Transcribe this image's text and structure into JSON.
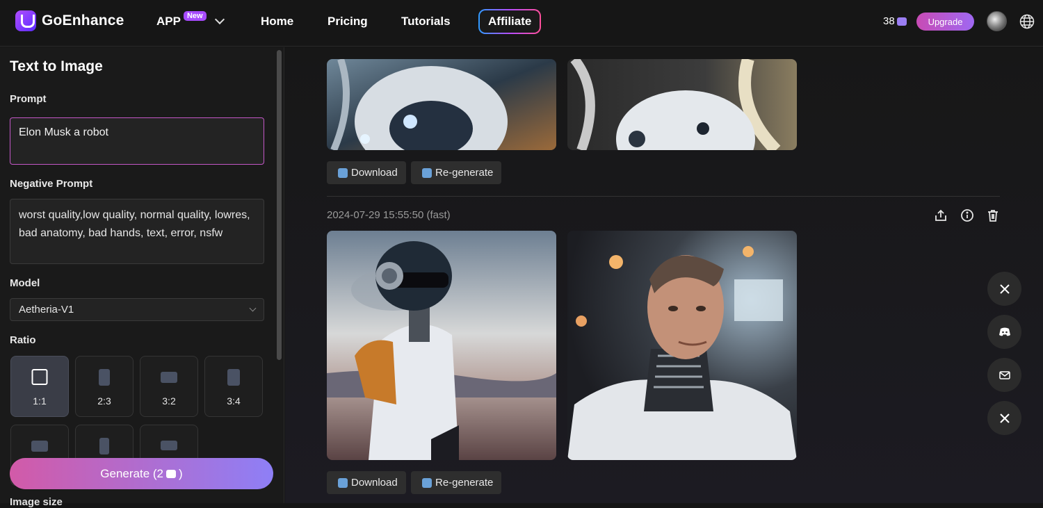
{
  "brand": {
    "name": "GoEnhance"
  },
  "nav": {
    "app": "APP",
    "new_badge": "New",
    "home": "Home",
    "pricing": "Pricing",
    "tutorials": "Tutorials",
    "affiliate": "Affiliate"
  },
  "account": {
    "credits": "38",
    "upgrade": "Upgrade"
  },
  "panel": {
    "title": "Text to Image",
    "prompt_label": "Prompt",
    "prompt_value": "Elon Musk a robot",
    "negative_label": "Negative Prompt",
    "negative_value": "worst quality,low quality, normal quality, lowres, bad anatomy, bad hands, text, error, nsfw",
    "model_label": "Model",
    "model_value": "Aetheria-V1",
    "ratio_label": "Ratio",
    "ratios": [
      "1:1",
      "2:3",
      "3:2",
      "3:4"
    ],
    "selected_ratio": "1:1",
    "generate": "Generate (2",
    "generate_suffix": ")",
    "image_size_label": "Image size"
  },
  "results": {
    "download": "Download",
    "regenerate": "Re-generate",
    "timestamp": "2024-07-29 15:55:50 (fast)"
  },
  "colors": {
    "accent": "#c457c8",
    "upgrade": "#b85cd0",
    "generate_start": "#d25aa8",
    "generate_end": "#8e7ff6"
  }
}
